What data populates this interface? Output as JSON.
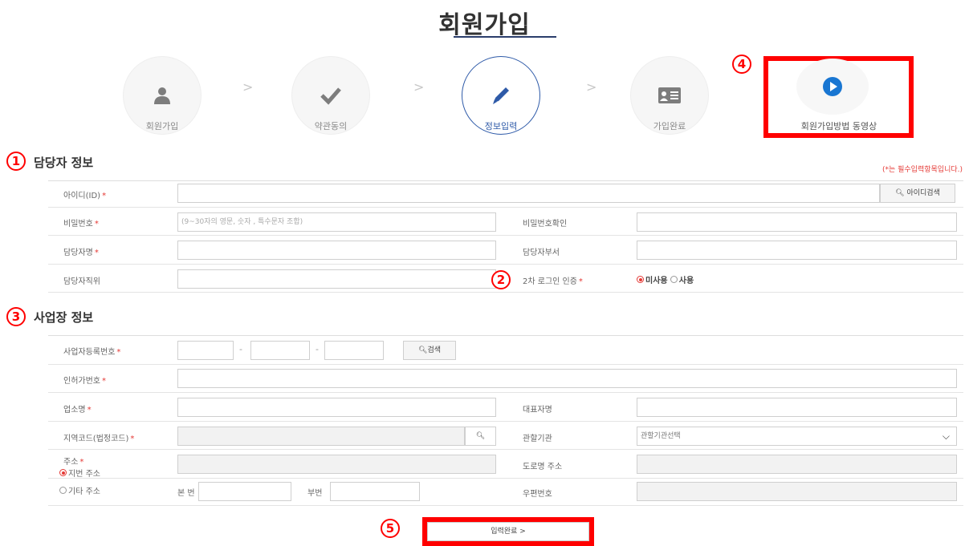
{
  "page_title": "회원가입",
  "steps": [
    {
      "label": "회원가입",
      "icon": "user-icon"
    },
    {
      "label": "약관동의",
      "icon": "check-icon"
    },
    {
      "label": "정보입력",
      "icon": "pencil-icon"
    },
    {
      "label": "가입완료",
      "icon": "id-card-icon"
    },
    {
      "label": "회원가입방법 동영상",
      "icon": "play-icon"
    }
  ],
  "step_arrow": ">",
  "callouts": {
    "one": "1",
    "two": "2",
    "three": "3",
    "four": "4",
    "five": "5"
  },
  "section1": {
    "title": "담당자 정보",
    "required_note": "(*는 필수입력항목입니다.)",
    "id_label": "아이디(ID)",
    "id_search_button": "아이디검색",
    "password_label": "비밀번호",
    "password_placeholder": "(9~30자의 영문, 숫자 , 특수문자 조합)",
    "password_confirm_label": "비밀번호확인",
    "manager_name_label": "담당자명",
    "manager_dept_label": "담당자부서",
    "manager_position_label": "담당자직위",
    "two_factor_label": "2차 로그인 인증",
    "two_factor_options": [
      "미사용",
      "사용"
    ]
  },
  "section2": {
    "title": "사업장 정보",
    "biz_number_label": "사업자등록번호",
    "biz_dash": "-",
    "search_button": "검색",
    "license_label": "인허가번호",
    "business_name_label": "업소명",
    "representative_label": "대표자명",
    "region_code_label": "지역코드(법정코드)",
    "authority_label": "관할기관",
    "authority_select_value": "관할기관선택",
    "address_label": "주소",
    "address_options": [
      "지번 주소",
      "기타 주소"
    ],
    "road_address_label": "도로명 주소",
    "main_number_label": "본 번",
    "sub_number_label": "부번",
    "postal_code_label": "우편번호"
  },
  "submit_button": "입력완료 >",
  "required_mark": "*",
  "colors": {
    "accent": "#2e5aa8",
    "required": "#e53935",
    "highlight_box": "#ff0000",
    "play_icon": "#1976d2"
  }
}
